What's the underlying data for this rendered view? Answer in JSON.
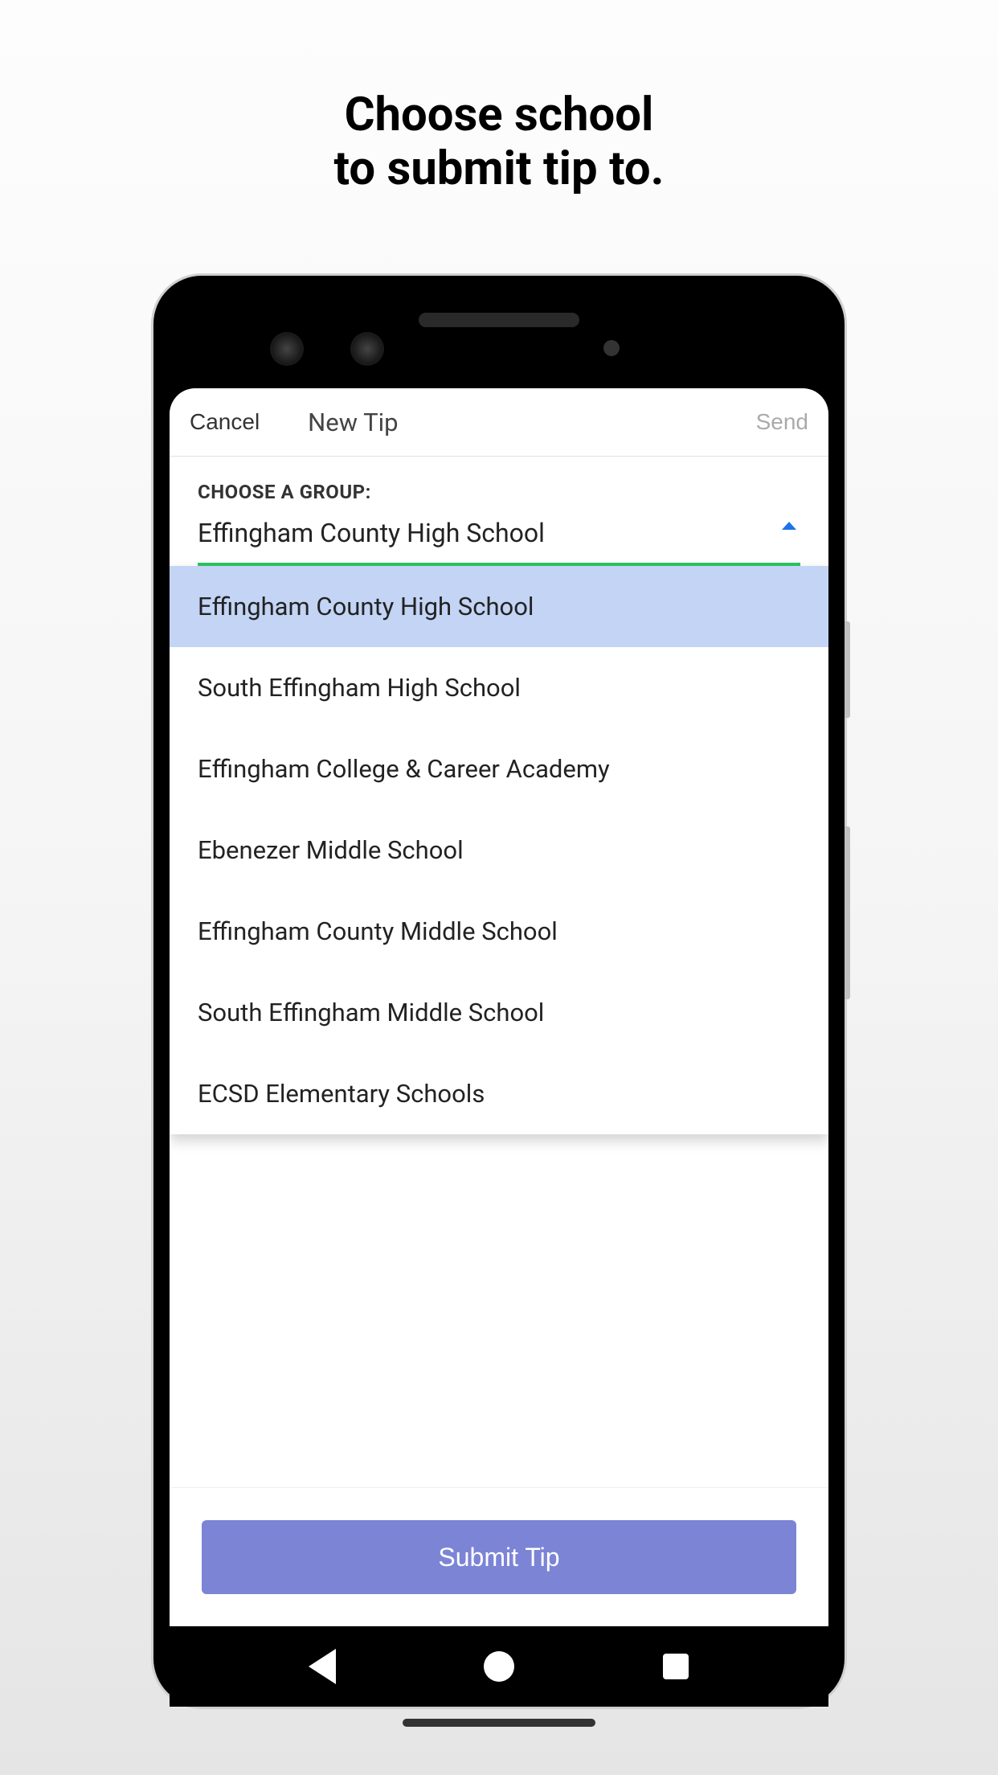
{
  "page": {
    "title_line1": "Choose school",
    "title_line2": "to submit tip to."
  },
  "header": {
    "cancel_label": "Cancel",
    "title": "New Tip",
    "send_label": "Send"
  },
  "form": {
    "group_label": "CHOOSE A GROUP:",
    "selected_value": "Effingham County High School",
    "options": [
      "Effingham County High School",
      "South Effingham High School",
      "Effingham College & Career Academy",
      "Ebenezer Middle School",
      "Effingham County Middle School",
      "South Effingham Middle School",
      "ECSD Elementary Schools"
    ],
    "selected_index": 0
  },
  "submit": {
    "label": "Submit Tip"
  }
}
